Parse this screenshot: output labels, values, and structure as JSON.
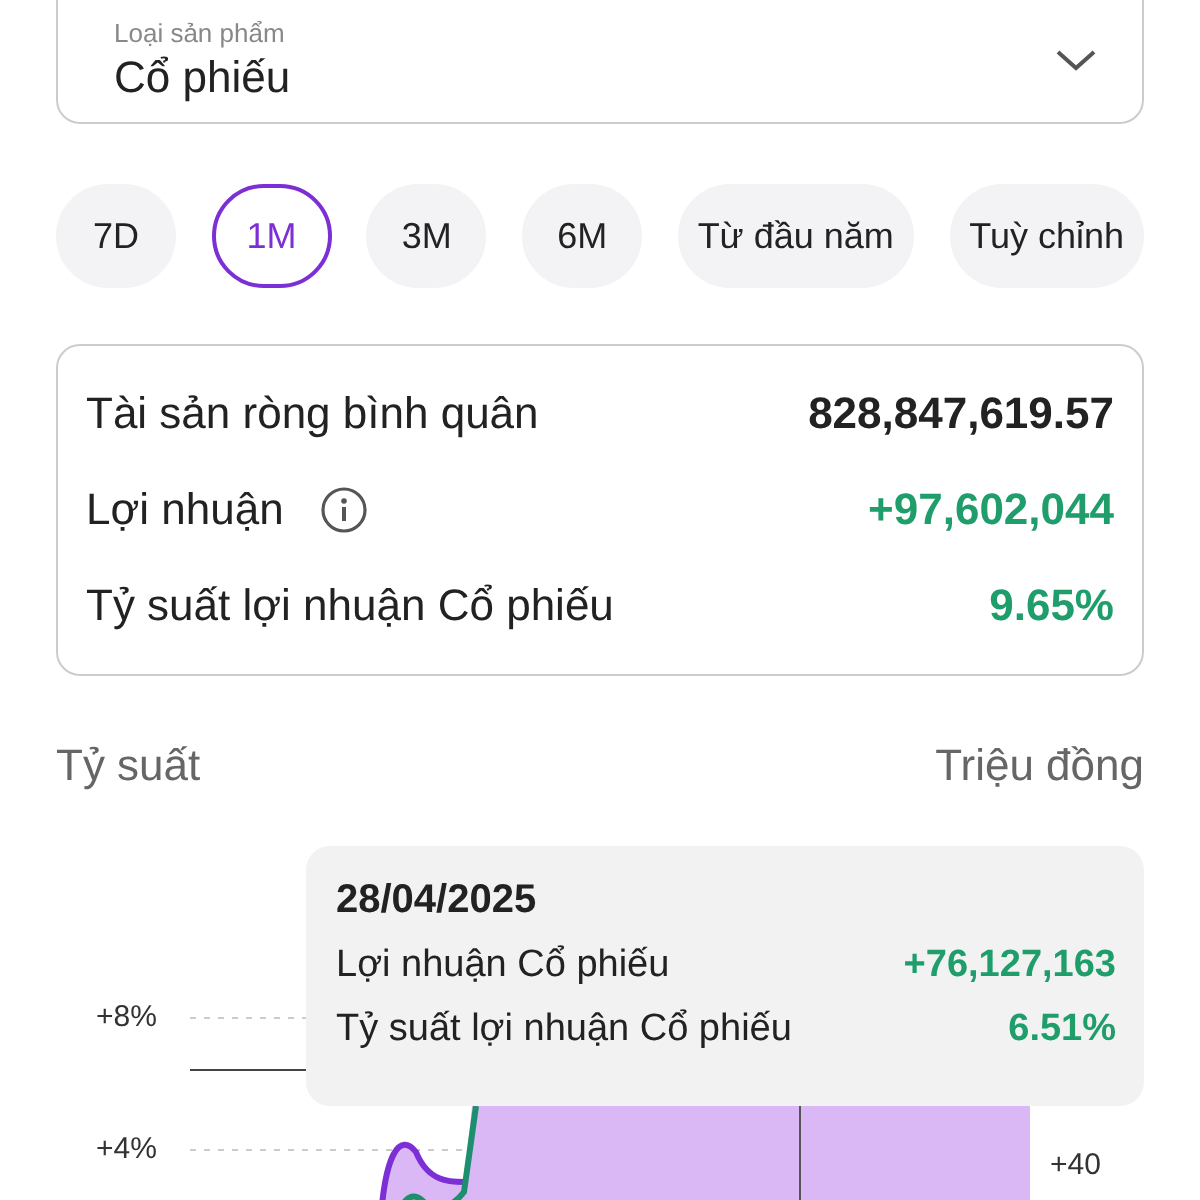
{
  "product_select": {
    "label": "Loại sản phẩm",
    "value": "Cổ phiếu"
  },
  "periods": [
    {
      "label": "7D",
      "selected": false
    },
    {
      "label": "1M",
      "selected": true
    },
    {
      "label": "3M",
      "selected": false
    },
    {
      "label": "6M",
      "selected": false
    },
    {
      "label": "Từ đầu năm",
      "selected": false
    },
    {
      "label": "Tuỳ chỉnh",
      "selected": false
    }
  ],
  "summary": [
    {
      "label": "Tài sản ròng bình quân",
      "value": "828,847,619.57",
      "kind": "plain",
      "info": false
    },
    {
      "label": "Lợi nhuận",
      "value": "+97,602,044",
      "kind": "positive",
      "info": true
    },
    {
      "label": "Tỷ suất lợi nhuận Cổ phiếu",
      "value": "9.65%",
      "kind": "positive",
      "info": false
    }
  ],
  "chart": {
    "left_title": "Tỷ suất",
    "right_title": "Triệu đồng",
    "left_ticks": [
      "+8%",
      "+4%"
    ],
    "right_ticks": [
      "+40"
    ],
    "tooltip": {
      "date": "28/04/2025",
      "rows": [
        {
          "label": "Lợi nhuận Cổ phiếu",
          "value": "+76,127,163",
          "kind": "positive"
        },
        {
          "label": "Tỷ suất lợi nhuận Cổ phiếu",
          "value": "6.51%",
          "kind": "positive"
        }
      ]
    }
  }
}
